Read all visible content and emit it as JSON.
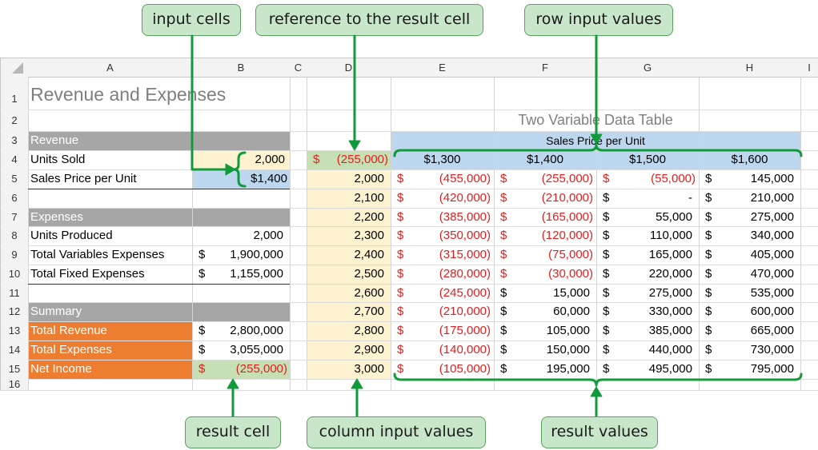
{
  "columns": [
    "A",
    "B",
    "C",
    "D",
    "E",
    "F",
    "G",
    "H",
    "I"
  ],
  "rows": [
    "1",
    "2",
    "3",
    "4",
    "5",
    "6",
    "7",
    "8",
    "9",
    "10",
    "11",
    "12",
    "13",
    "14",
    "15",
    "16"
  ],
  "sheet": {
    "title": "Revenue and Expenses",
    "revenue_header": "Revenue",
    "units_sold_label": "Units Sold",
    "units_sold_value": "2,000",
    "sales_price_label": "Sales Price per Unit",
    "sales_price_value": "$1,400",
    "expenses_header": "Expenses",
    "units_produced_label": "Units Produced",
    "units_produced_value": "2,000",
    "total_var_label": "Total Variables Expenses",
    "total_var_value": "1,900,000",
    "total_fixed_label": "Total Fixed Expenses",
    "total_fixed_value": "1,155,000",
    "summary_header": "Summary",
    "total_revenue_label": "Total Revenue",
    "total_revenue_value": "2,800,000",
    "total_expenses_label": "Total Expenses",
    "total_expenses_value": "3,055,000",
    "net_income_label": "Net Income",
    "net_income_value": "(255,000)",
    "dollar": "$"
  },
  "data_table": {
    "title": "Two Variable Data Table",
    "row_header": "Sales Price per Unit",
    "reference_value": "(255,000)",
    "prices": [
      "$1,300",
      "$1,400",
      "$1,500",
      "$1,600"
    ],
    "units": [
      "2,000",
      "2,100",
      "2,200",
      "2,300",
      "2,400",
      "2,500",
      "2,600",
      "2,700",
      "2,800",
      "2,900",
      "3,000"
    ],
    "results": [
      [
        "(455,000)",
        "(255,000)",
        "(55,000)",
        "145,000"
      ],
      [
        "(420,000)",
        "(210,000)",
        "-",
        "210,000"
      ],
      [
        "(385,000)",
        "(165,000)",
        "55,000",
        "275,000"
      ],
      [
        "(350,000)",
        "(120,000)",
        "110,000",
        "340,000"
      ],
      [
        "(315,000)",
        "(75,000)",
        "165,000",
        "405,000"
      ],
      [
        "(280,000)",
        "(30,000)",
        "220,000",
        "470,000"
      ],
      [
        "(245,000)",
        "15,000",
        "275,000",
        "535,000"
      ],
      [
        "(210,000)",
        "60,000",
        "330,000",
        "600,000"
      ],
      [
        "(175,000)",
        "105,000",
        "385,000",
        "665,000"
      ],
      [
        "(140,000)",
        "150,000",
        "440,000",
        "730,000"
      ],
      [
        "(105,000)",
        "195,000",
        "495,000",
        "795,000"
      ]
    ]
  },
  "callouts": {
    "input_cells": "input cells",
    "reference": "reference to the result cell",
    "row_input": "row input values",
    "result_cell": "result cell",
    "column_input": "column input values",
    "result_values": "result values"
  },
  "colors": {
    "gray_header": "#a6a6a6",
    "input_yellow": "#fdf3d0",
    "price_blue": "#bdd7ee",
    "orange": "#ed7d31",
    "green_result": "#c6e0b4",
    "negative_red": "#e02020",
    "callout_green": "#c8e6c9",
    "arrow_green": "#119a3a"
  }
}
